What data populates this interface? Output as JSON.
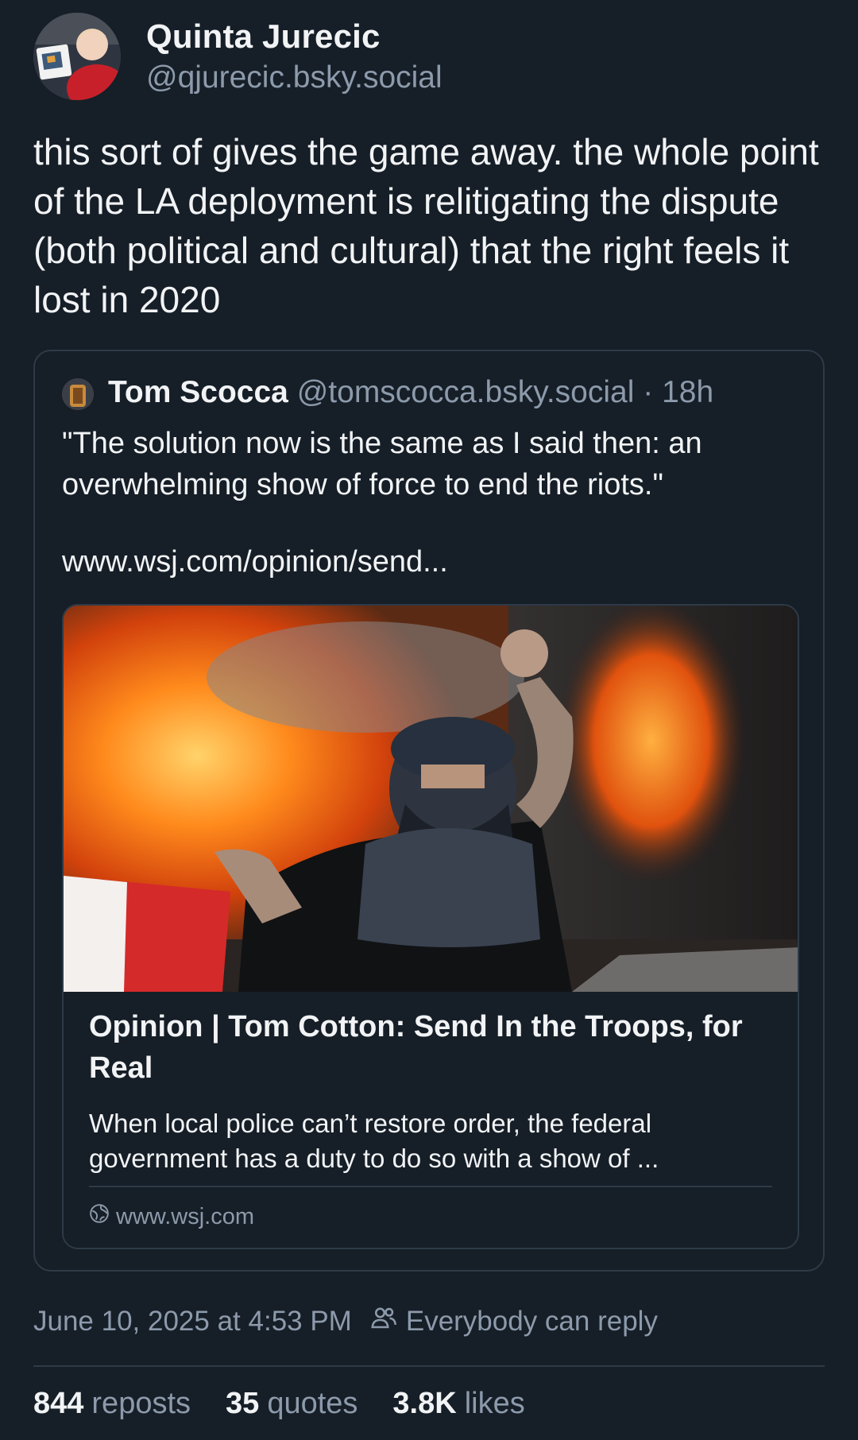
{
  "author": {
    "name": "Quinta Jurecic",
    "handle": "@qjurecic.bsky.social"
  },
  "post": {
    "text": "this sort of gives the game away. the whole point of the LA deployment is relitigating the dispute (both political and cultural) that the right feels it lost in 2020"
  },
  "quote": {
    "author_name": "Tom Scocca",
    "author_handle": "@tomscocca.bsky.social",
    "separator": "·",
    "time_ago": "18h",
    "text": "\"The solution now is the same as I said then: an overwhelming show of force to end the riots.\"",
    "link_text": "www.wsj.com/opinion/send...",
    "embed": {
      "title": "Opinion | Tom Cotton: Send In the Troops, for Real",
      "description": "When local police can’t restore order, the federal government has a duty to do so with a show of ...",
      "domain": "www.wsj.com"
    }
  },
  "meta": {
    "timestamp": "June 10, 2025 at 4:53 PM",
    "reply_setting": "Everybody can reply"
  },
  "stats": {
    "reposts_count": "844",
    "reposts_label": "reposts",
    "quotes_count": "35",
    "quotes_label": "quotes",
    "likes_count": "3.8K",
    "likes_label": "likes"
  },
  "icons": {
    "globe": "globe-icon",
    "reply_audience": "people-icon"
  },
  "colors": {
    "background": "#161e27",
    "text_primary": "#f1f3f5",
    "text_secondary": "#8c9aab",
    "border": "#2e3a48"
  }
}
